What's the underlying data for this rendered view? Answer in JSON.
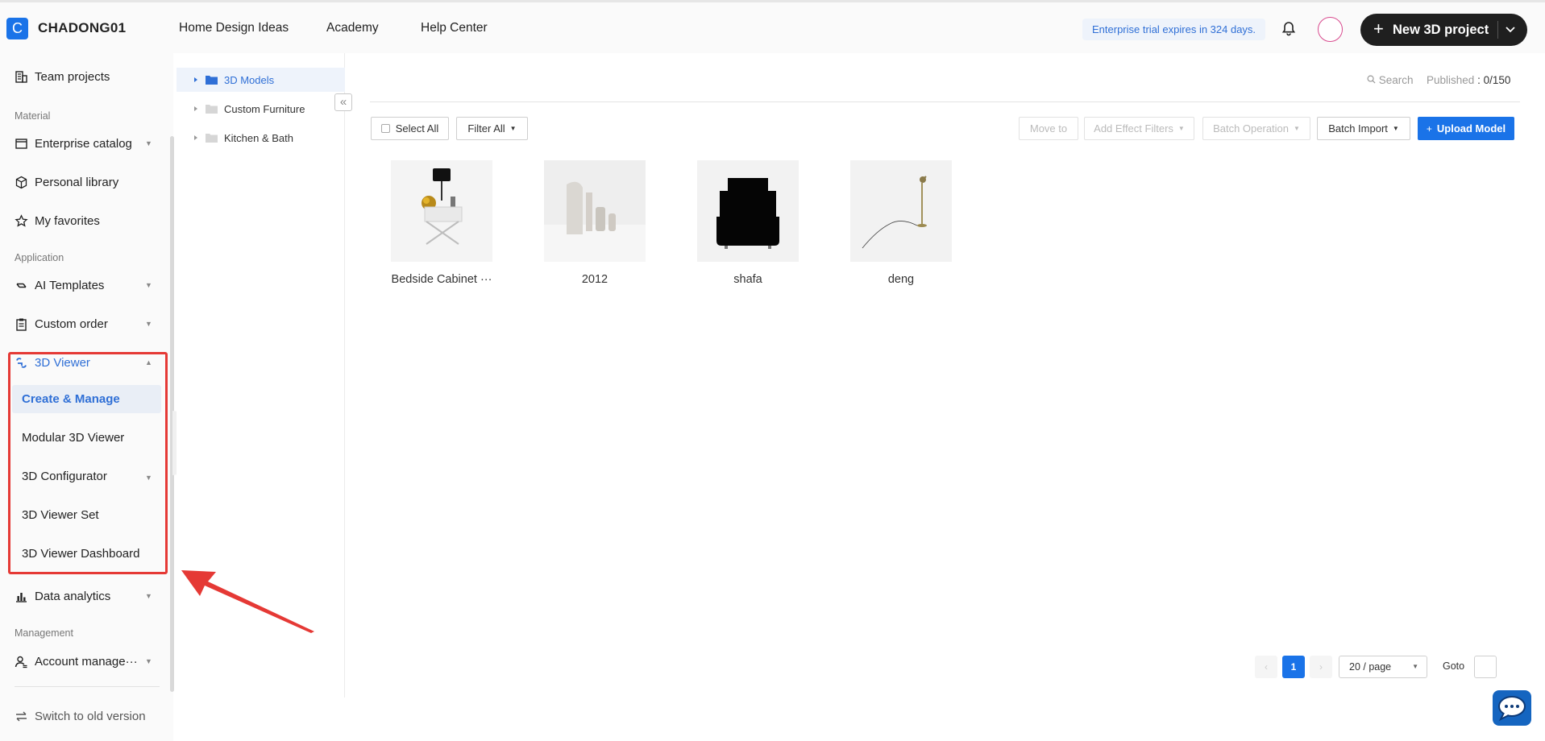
{
  "header": {
    "logo_letter": "C",
    "brand": "CHADONG01",
    "nav": [
      "Home Design Ideas",
      "Academy",
      "Help Center"
    ],
    "trial_text": "Enterprise trial expires in 324 days.",
    "new_project_label": "New 3D project"
  },
  "sidebar": {
    "team_projects": "Team projects",
    "section_material": "Material",
    "enterprise_catalog": "Enterprise catalog",
    "personal_library": "Personal library",
    "my_favorites": "My favorites",
    "section_application": "Application",
    "ai_templates": "AI Templates",
    "custom_order": "Custom order",
    "viewer": "3D Viewer",
    "viewer_items": [
      "Create & Manage",
      "Modular 3D Viewer",
      "3D Configurator",
      "3D Viewer Set",
      "3D Viewer Dashboard"
    ],
    "data_analytics": "Data analytics",
    "section_management": "Management",
    "account_manage": "Account manage···",
    "switch_old": "Switch to old version"
  },
  "tree": {
    "folders": [
      "3D Models",
      "Custom Furniture",
      "Kitchen & Bath"
    ]
  },
  "toolbar": {
    "search": "Search",
    "published_label": "Published",
    "published_value": ": 0/150",
    "select_all": "Select All",
    "filter_all": "Filter All",
    "move_to": "Move to",
    "add_effect_filters": "Add Effect Filters",
    "batch_operation": "Batch Operation",
    "batch_import": "Batch Import",
    "upload_model": "Upload Model"
  },
  "models": [
    {
      "name": "Bedside Cabinet ···"
    },
    {
      "name": "2012"
    },
    {
      "name": "shafa"
    },
    {
      "name": "deng"
    }
  ],
  "pagination": {
    "current_page": "1",
    "page_size": "20 / page",
    "goto_label": "Goto"
  },
  "colors": {
    "accent": "#1a73e8",
    "highlight": "#e53935"
  }
}
